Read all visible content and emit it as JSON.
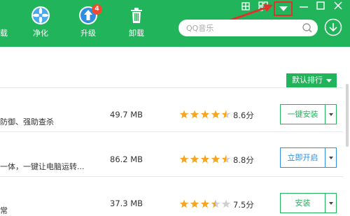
{
  "nav": [
    {
      "label": "载",
      "icon": "download-icon"
    },
    {
      "label": "净化",
      "icon": "purify-icon"
    },
    {
      "label": "升级",
      "icon": "upgrade-icon",
      "badge": "4"
    },
    {
      "label": "卸载",
      "icon": "trash-icon"
    }
  ],
  "search": {
    "placeholder": "QQ音乐"
  },
  "sort": {
    "label": "默认排行"
  },
  "apps": [
    {
      "desc": "防御、强助查杀",
      "size": "49.7 MB",
      "rating": 4.5,
      "score": "8.6分",
      "action": "一键安装",
      "action_color": "#21b45a"
    },
    {
      "desc": "一体，一键让电脑运转...",
      "size": "86.2 MB",
      "rating": 4.5,
      "score": "8.8分",
      "action": "立即开启",
      "action_color": "#2f8ee0"
    },
    {
      "desc": "常",
      "size": "37.3 MB",
      "rating": 3.5,
      "score": "7.5分",
      "action": "安装",
      "action_color": "#21b45a"
    }
  ],
  "colors": {
    "header": "#21b45a",
    "star": "#f5a623",
    "highlight": "#e0322a"
  }
}
